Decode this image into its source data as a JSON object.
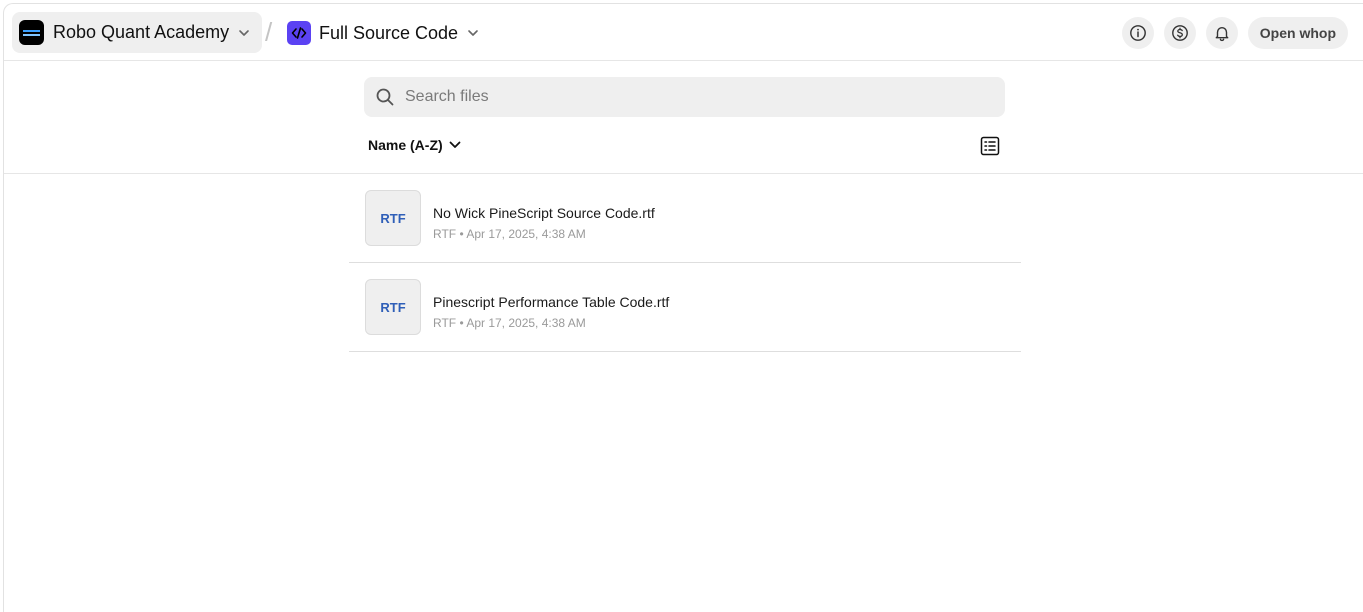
{
  "header": {
    "app_name": "Robo Quant Academy",
    "separator": "/",
    "section_name": "Full Source Code",
    "open_button": "Open whop",
    "icons": [
      "info-icon",
      "dollar-icon",
      "bell-icon"
    ],
    "accent_color": "#5b42f3"
  },
  "search": {
    "placeholder": "Search files",
    "value": ""
  },
  "toolbar": {
    "sort_label": "Name (A-Z)",
    "view_icon": "list-view-icon"
  },
  "files": [
    {
      "type": "RTF",
      "name": "No Wick PineScript Source Code.rtf",
      "meta": "RTF • Apr 17, 2025, 4:38 AM"
    },
    {
      "type": "RTF",
      "name": "Pinescript Performance Table Code.rtf",
      "meta": "RTF • Apr 17, 2025, 4:38 AM"
    }
  ]
}
